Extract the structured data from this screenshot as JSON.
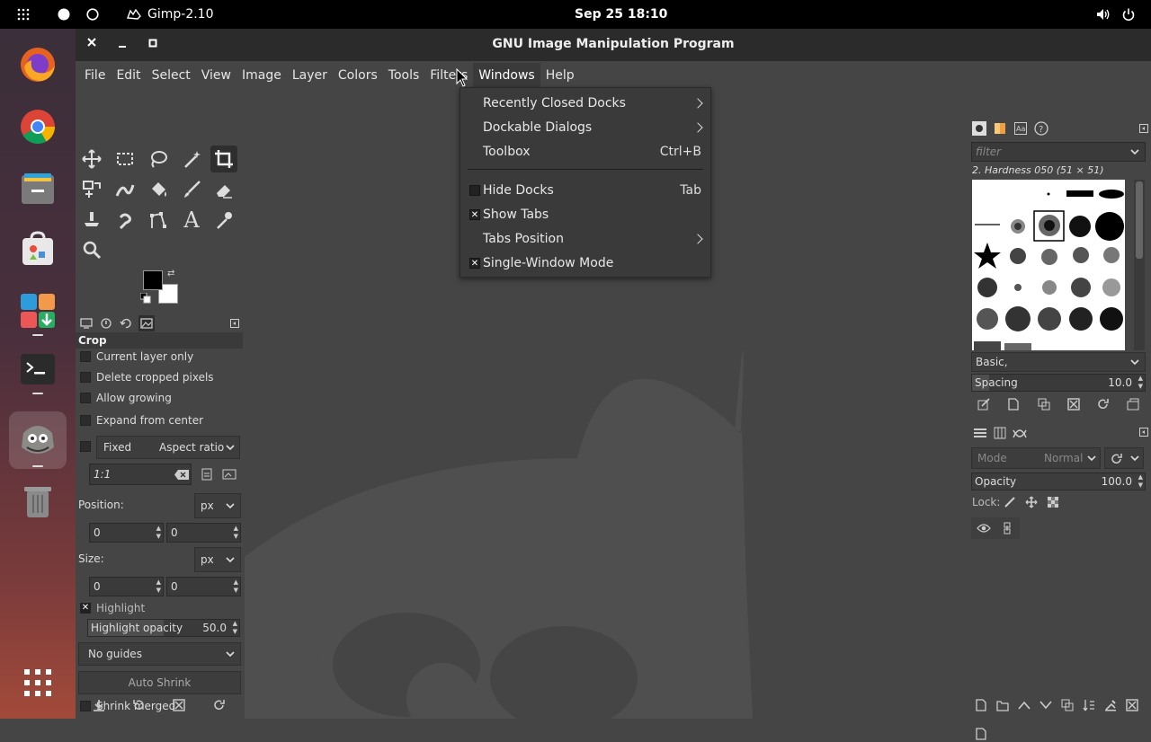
{
  "topbar": {
    "app_name": "Gimp-2.10",
    "clock": "Sep 25  18:10"
  },
  "dock": {
    "items": [
      "firefox-icon",
      "chrome-icon",
      "files-icon",
      "software-icon",
      "app-grid-store-icon",
      "terminal-icon",
      "gimp-icon",
      "trash-icon",
      "show-apps-icon"
    ]
  },
  "window": {
    "title": "GNU Image Manipulation Program"
  },
  "menubar": {
    "items": [
      "File",
      "Edit",
      "Select",
      "View",
      "Image",
      "Layer",
      "Colors",
      "Tools",
      "Filters",
      "Windows",
      "Help"
    ]
  },
  "windows_menu": {
    "items": [
      {
        "label": "Recently Closed Docks",
        "submenu": true
      },
      {
        "label": "Dockable Dialogs",
        "submenu": true
      },
      {
        "label": "Toolbox",
        "accel": "Ctrl+B"
      },
      {
        "label": "Hide Docks",
        "accel": "Tab",
        "checked": false
      },
      {
        "label": "Show Tabs",
        "checked": true
      },
      {
        "label": "Tabs Position",
        "submenu": true
      },
      {
        "label": "Single-Window Mode",
        "checked": true
      }
    ]
  },
  "tool_options": {
    "title": "Crop",
    "current_layer_only": "Current layer only",
    "delete_cropped": "Delete cropped pixels",
    "allow_growing": "Allow growing",
    "expand_center": "Expand from center",
    "fixed": "Fixed",
    "aspect": "Aspect ratio",
    "ratio_value": "1:1",
    "position_label": "Position:",
    "position_unit": "px",
    "pos_x": "0",
    "pos_y": "0",
    "size_label": "Size:",
    "size_unit": "px",
    "size_w": "0",
    "size_h": "0",
    "highlight": "Highlight",
    "highlight_opacity_label": "Highlight opacity",
    "highlight_opacity_value": "50.0",
    "guides": "No guides",
    "auto_shrink": "Auto Shrink",
    "shrink_merged": "Shrink merged"
  },
  "brushes": {
    "filter_placeholder": "filter",
    "selected": "2. Hardness 050 (51 × 51)",
    "set": "Basic,",
    "spacing_label": "Spacing",
    "spacing_value": "10.0"
  },
  "layers": {
    "mode_label": "Mode",
    "mode_value": "Normal",
    "opacity_label": "Opacity",
    "opacity_value": "100.0",
    "lock_label": "Lock:"
  },
  "colors": {
    "fg": "#000000",
    "bg": "#ffffff"
  }
}
